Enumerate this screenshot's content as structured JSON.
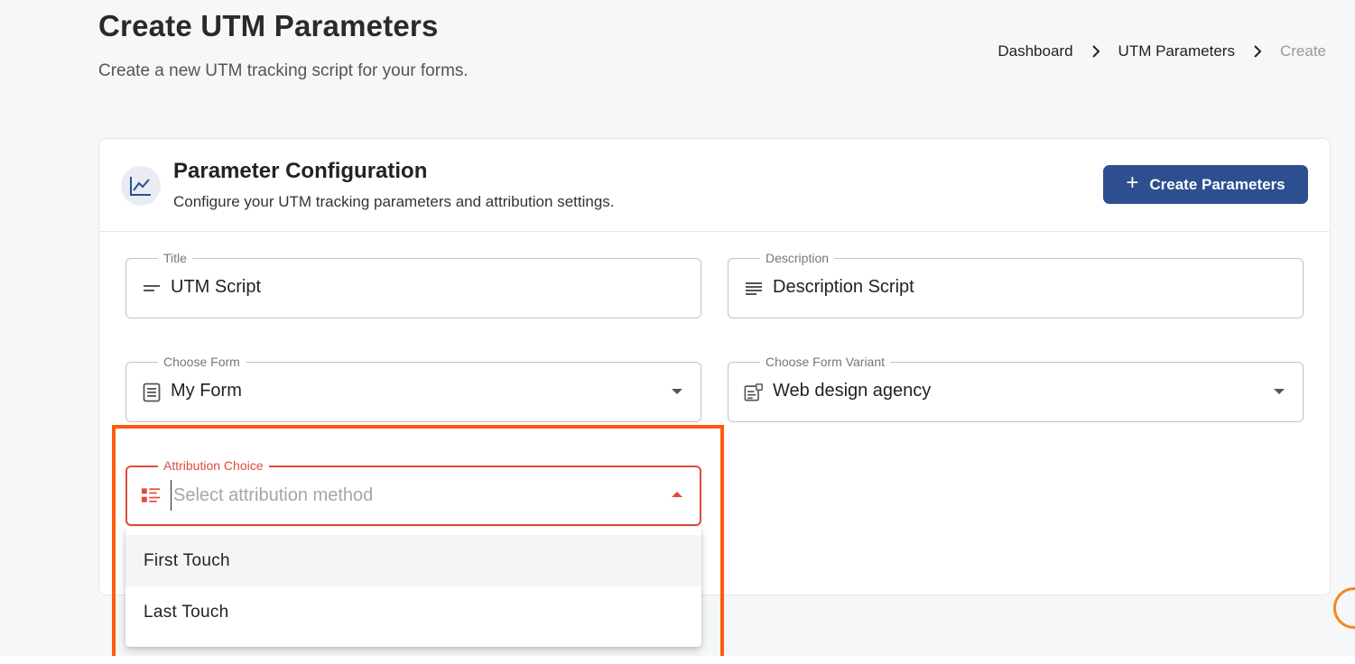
{
  "header": {
    "title": "Create UTM Parameters",
    "subtitle": "Create a new UTM tracking script for your forms."
  },
  "breadcrumb": {
    "items": [
      "Dashboard",
      "UTM Parameters",
      "Create"
    ]
  },
  "card": {
    "icon": "line-chart-icon",
    "title": "Parameter Configuration",
    "subtitle": "Configure your UTM tracking parameters and attribution settings.",
    "create_button_label": "Create Parameters",
    "create_button_icon": "plus-icon"
  },
  "fields": {
    "title": {
      "label": "Title",
      "value": "UTM Script",
      "icon": "short-text-icon"
    },
    "description": {
      "label": "Description",
      "value": "Description Script",
      "icon": "notes-icon"
    },
    "form": {
      "label": "Choose Form",
      "value": "My Form",
      "icon": "form-icon"
    },
    "form_variant": {
      "label": "Choose Form Variant",
      "value": "Web design agency",
      "icon": "variant-icon"
    },
    "attribution": {
      "label": "Attribution Choice",
      "placeholder": "Select attribution method",
      "icon": "list-icon",
      "options": [
        "First Touch",
        "Last Touch"
      ]
    }
  },
  "colors": {
    "primary": "#2e4f8f",
    "error": "#e04b3c",
    "highlight": "#ff5a0f"
  }
}
